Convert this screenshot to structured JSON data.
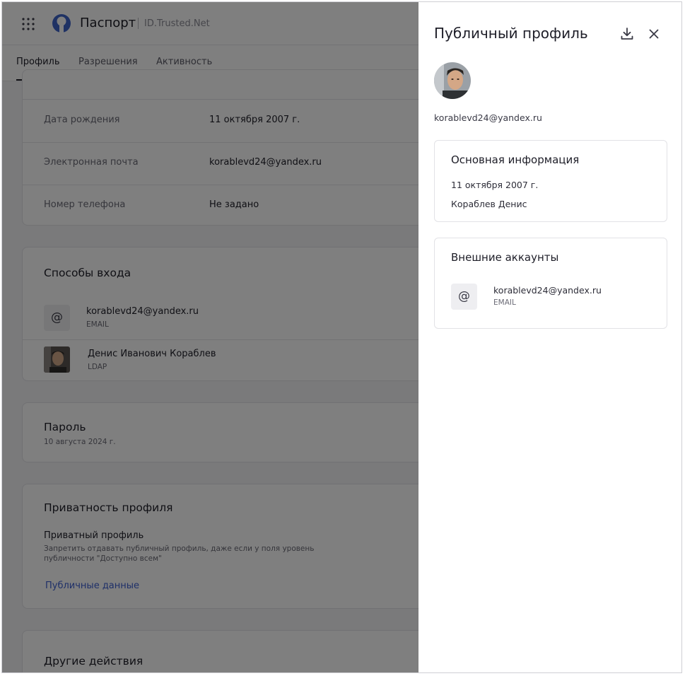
{
  "app": {
    "title": "Паспорт",
    "domain": "ID.Trusted.Net"
  },
  "tabs": [
    {
      "label": "Профиль",
      "active": true
    },
    {
      "label": "Разрешения",
      "active": false
    },
    {
      "label": "Активность",
      "active": false
    }
  ],
  "personal_info": {
    "rows": [
      {
        "label": "Дата рождения",
        "value": "11 октября 2007 г."
      },
      {
        "label": "Электронная почта",
        "value": "korablevd24@yandex.ru"
      },
      {
        "label": "Номер телефона",
        "value": "Не задано"
      }
    ]
  },
  "login_methods": {
    "title": "Способы входа",
    "items": [
      {
        "name": "korablevd24@yandex.ru",
        "type": "EMAIL",
        "icon": "at-icon"
      },
      {
        "name": "Денис Иванович Кораблев",
        "type": "LDAP",
        "icon": "avatar"
      }
    ]
  },
  "password": {
    "title": "Пароль",
    "date": "10 августа 2024 г."
  },
  "privacy": {
    "title": "Приватность профиля",
    "option_label": "Приватный профиль",
    "option_description": "Запретить отдавать публичный профиль, даже если у поля уровень публичности \"Доступно всем\"",
    "link": "Публичные данные"
  },
  "other_actions": {
    "title": "Другие действия"
  },
  "panel": {
    "title": "Публичный профиль",
    "email": "korablevd24@yandex.ru",
    "main_info": {
      "title": "Основная информация",
      "birth_date": "11 октября 2007 г.",
      "name": "Кораблев Денис"
    },
    "external_accounts": {
      "title": "Внешние аккаунты",
      "items": [
        {
          "name": "korablevd24@yandex.ru",
          "type": "EMAIL",
          "icon": "at-icon"
        }
      ]
    },
    "icons": {
      "download": "download-icon",
      "close": "close-icon"
    }
  },
  "colors": {
    "accent_link": "#3c5fd1",
    "overlay": "rgba(0,0,0,0.5)",
    "logo_blue": "#3e64c8"
  }
}
